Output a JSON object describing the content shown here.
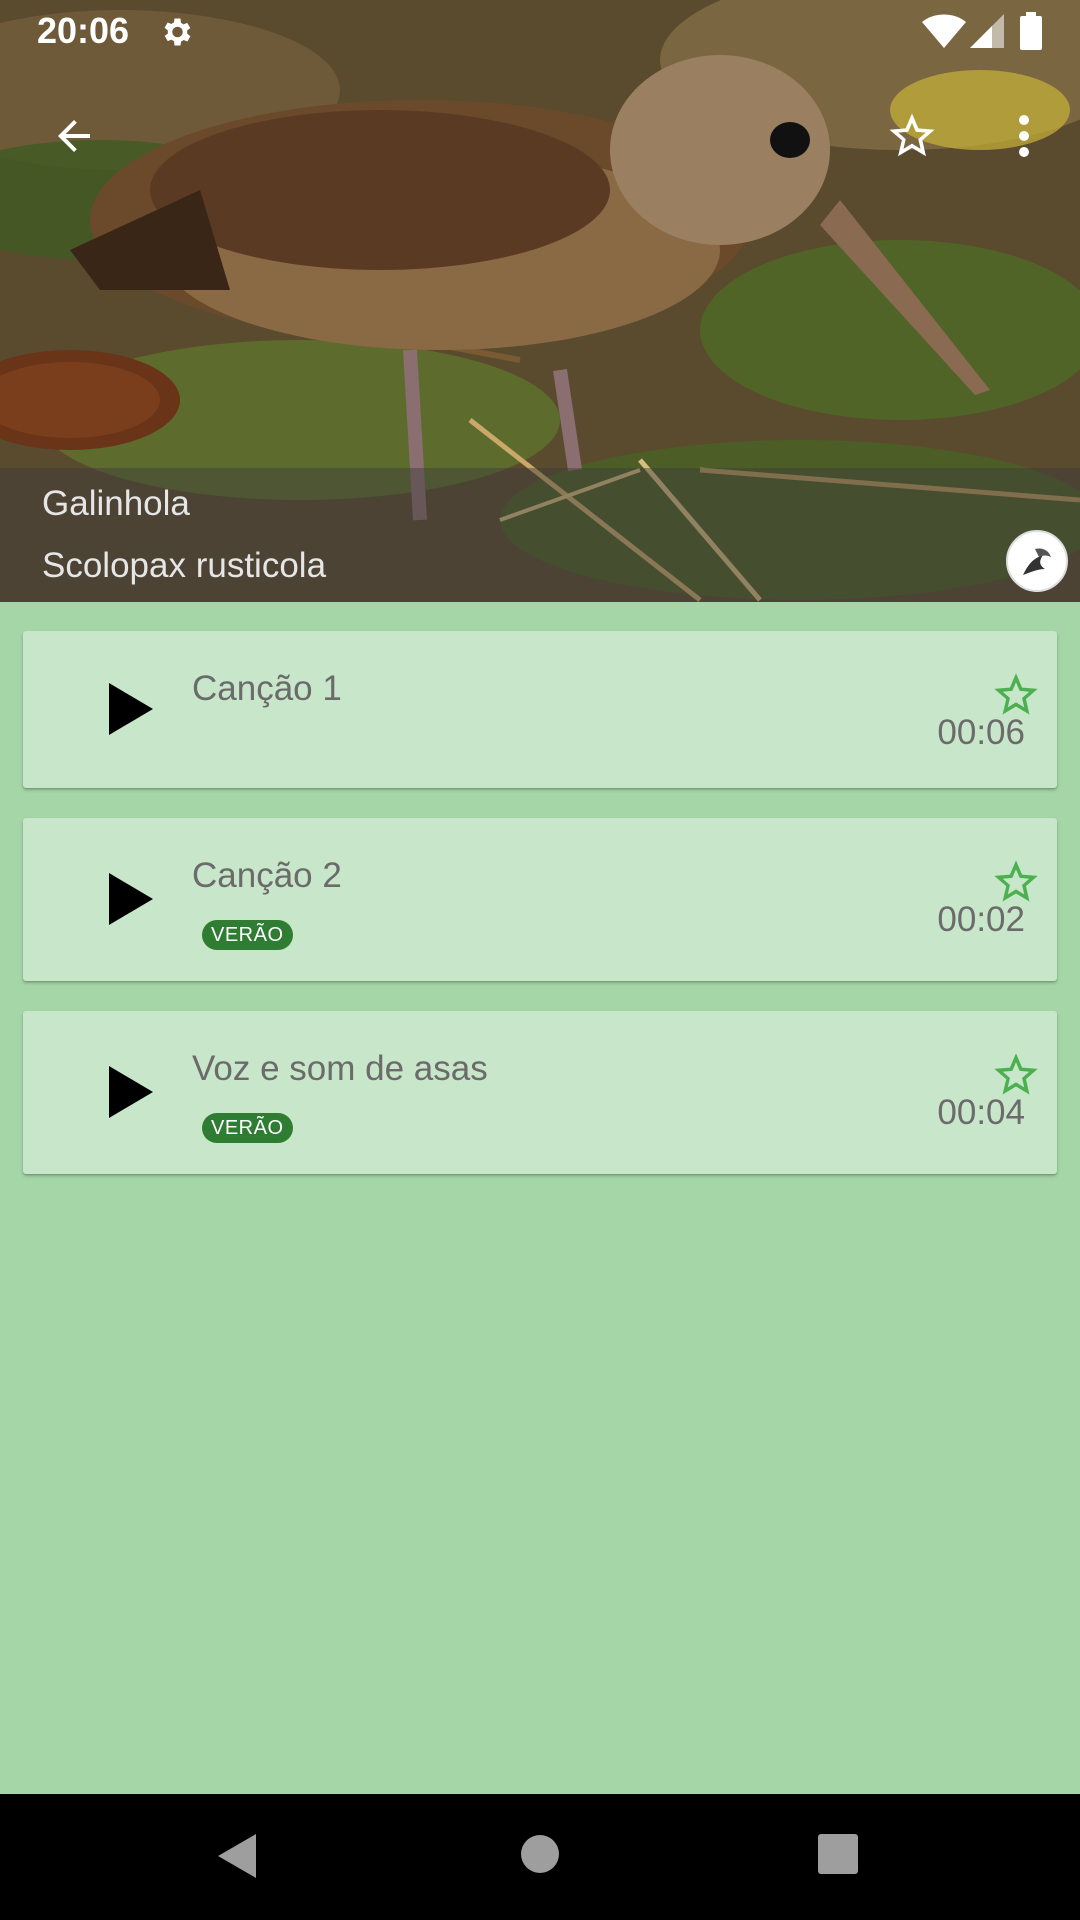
{
  "status_bar": {
    "time": "20:06",
    "icons": [
      "settings-icon",
      "wifi-icon",
      "signal-icon",
      "battery-icon"
    ]
  },
  "app_bar": {
    "icons": [
      "back-arrow-icon",
      "star-outline-icon",
      "more-vert-icon"
    ]
  },
  "species": {
    "common_name": "Galinhola",
    "scientific_name": "Scolopax rusticola"
  },
  "sounds": [
    {
      "title": "Canção 1",
      "duration": "00:06",
      "badge": ""
    },
    {
      "title": "Canção 2",
      "duration": "00:02",
      "badge": "VERÃO"
    },
    {
      "title": "Voz e som de asas",
      "duration": "00:04",
      "badge": "VERÃO"
    }
  ],
  "nav_bar": {
    "icons": [
      "nav-back-icon",
      "nav-home-icon",
      "nav-recents-icon"
    ]
  },
  "colors": {
    "background": "#a5d6a7",
    "card": "#c8e6c9",
    "badge": "#2e7d32",
    "star": "#4caf50",
    "text_secondary": "#6b6b6b"
  }
}
